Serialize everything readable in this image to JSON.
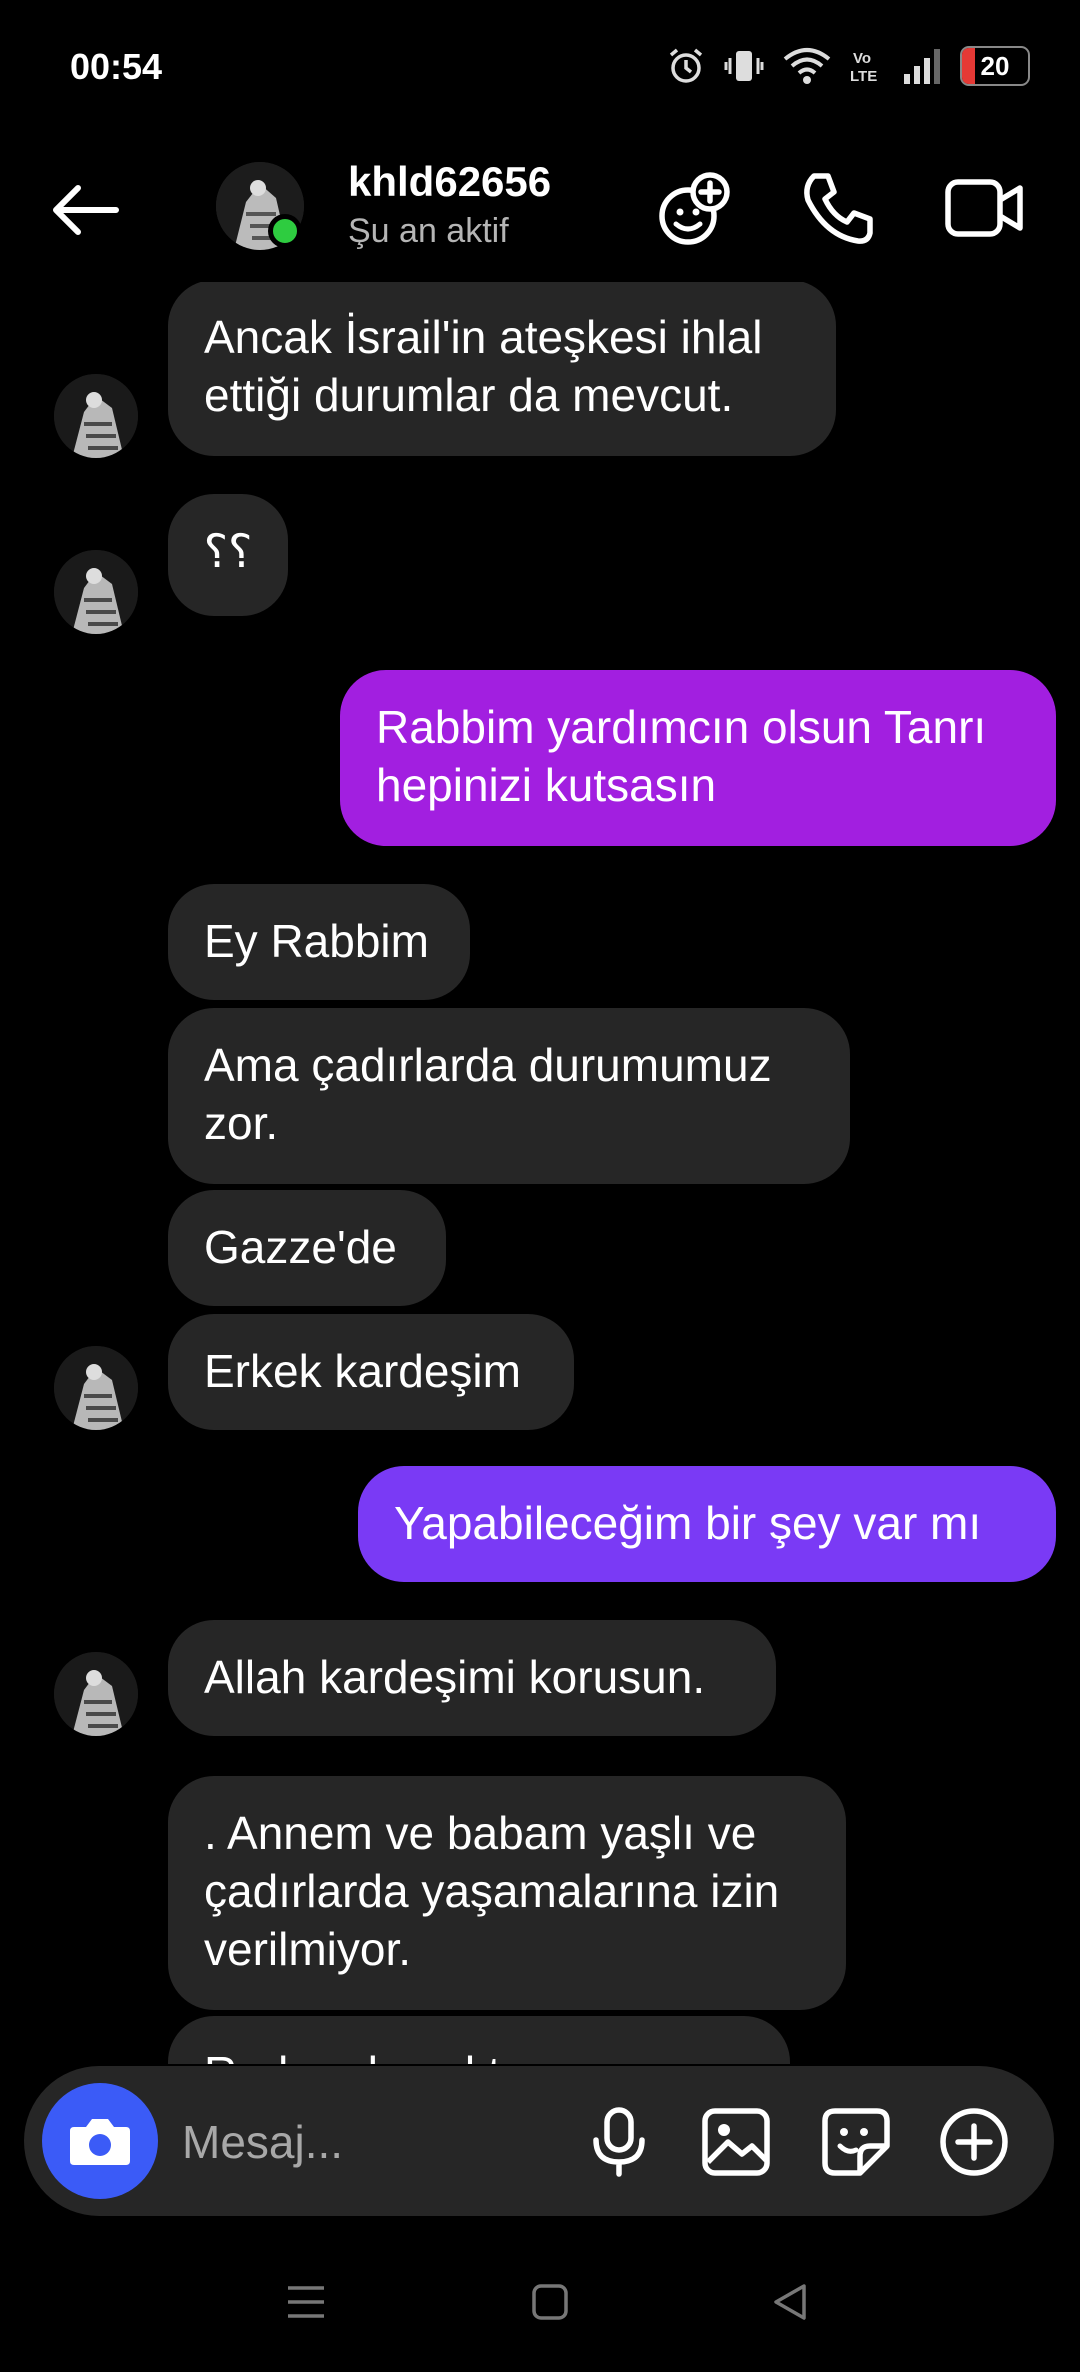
{
  "status_bar": {
    "time": "00:54",
    "battery_level": "20",
    "battery_fraction": 0.2
  },
  "header": {
    "username": "khld62656",
    "status": "Şu an aktif"
  },
  "colors": {
    "incoming": "#262626",
    "outgoing_1": "#a21fe0",
    "outgoing_2": "#7a3af5",
    "camera_button": "#3b5bf7",
    "online": "#2ecc40"
  },
  "messages": [
    {
      "text": "Ancak İsrail'in ateşkesi ihlal ettiği durumlar da mevcut."
    },
    {
      "text": "؟؟"
    },
    {
      "text": "Rabbim yardımcın olsun Tanrı hepinizi kutsasın"
    },
    {
      "text": "Ey Rabbim"
    },
    {
      "text": "Ama çadırlarda durumumuz zor."
    },
    {
      "text": "Gazze'de"
    },
    {
      "text": "Erkek kardeşim"
    },
    {
      "text": "Yapabileceğim bir şey var mı"
    },
    {
      "text": "Allah kardeşimi korusun."
    },
    {
      "text": ".  Annem ve babam yaşlı ve çadırlarda yaşamalarına izin verilmiyor."
    },
    {
      "text": "Rudaa da yoktur ama"
    }
  ],
  "composer": {
    "placeholder": "Mesaj..."
  }
}
